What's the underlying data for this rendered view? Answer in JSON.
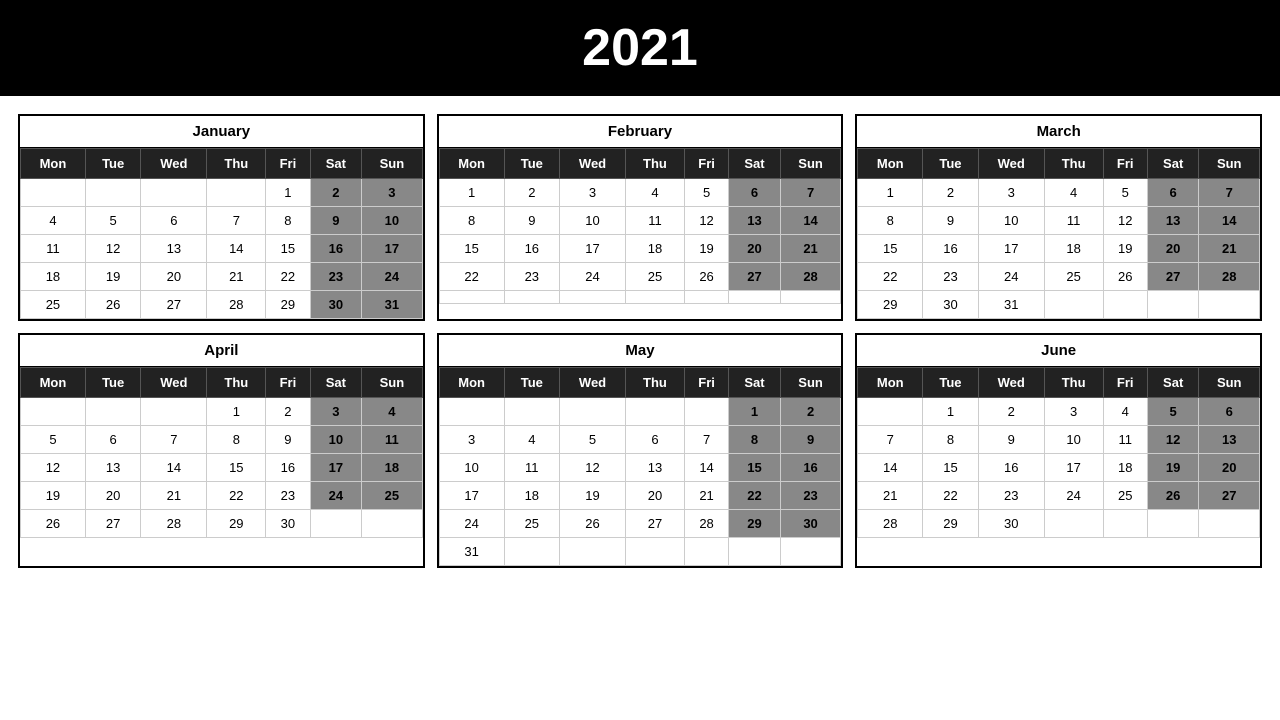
{
  "year": "2021",
  "months": [
    {
      "name": "January",
      "weeks": [
        [
          "",
          "",
          "",
          "",
          "1",
          "2",
          "3"
        ],
        [
          "4",
          "5",
          "6",
          "7",
          "8",
          "9",
          "10"
        ],
        [
          "11",
          "12",
          "13",
          "14",
          "15",
          "16",
          "17"
        ],
        [
          "18",
          "19",
          "20",
          "21",
          "22",
          "23",
          "24"
        ],
        [
          "25",
          "26",
          "27",
          "28",
          "29",
          "30",
          "31"
        ]
      ]
    },
    {
      "name": "February",
      "weeks": [
        [
          "1",
          "2",
          "3",
          "4",
          "5",
          "6",
          "7"
        ],
        [
          "8",
          "9",
          "10",
          "11",
          "12",
          "13",
          "14"
        ],
        [
          "15",
          "16",
          "17",
          "18",
          "19",
          "20",
          "21"
        ],
        [
          "22",
          "23",
          "24",
          "25",
          "26",
          "27",
          "28"
        ],
        [
          "",
          "",
          "",
          "",
          "",
          "",
          ""
        ]
      ]
    },
    {
      "name": "March",
      "weeks": [
        [
          "1",
          "2",
          "3",
          "4",
          "5",
          "6",
          "7"
        ],
        [
          "8",
          "9",
          "10",
          "11",
          "12",
          "13",
          "14"
        ],
        [
          "15",
          "16",
          "17",
          "18",
          "19",
          "20",
          "21"
        ],
        [
          "22",
          "23",
          "24",
          "25",
          "26",
          "27",
          "28"
        ],
        [
          "29",
          "30",
          "31",
          "",
          "",
          "",
          ""
        ]
      ]
    },
    {
      "name": "April",
      "weeks": [
        [
          "",
          "",
          "",
          "1",
          "2",
          "3",
          "4"
        ],
        [
          "5",
          "6",
          "7",
          "8",
          "9",
          "10",
          "11"
        ],
        [
          "12",
          "13",
          "14",
          "15",
          "16",
          "17",
          "18"
        ],
        [
          "19",
          "20",
          "21",
          "22",
          "23",
          "24",
          "25"
        ],
        [
          "26",
          "27",
          "28",
          "29",
          "30",
          "",
          ""
        ]
      ]
    },
    {
      "name": "May",
      "weeks": [
        [
          "",
          "",
          "",
          "",
          "",
          "1",
          "2"
        ],
        [
          "3",
          "4",
          "5",
          "6",
          "7",
          "8",
          "9"
        ],
        [
          "10",
          "11",
          "12",
          "13",
          "14",
          "15",
          "16"
        ],
        [
          "17",
          "18",
          "19",
          "20",
          "21",
          "22",
          "23"
        ],
        [
          "24",
          "25",
          "26",
          "27",
          "28",
          "29",
          "30"
        ],
        [
          "31",
          "",
          "",
          "",
          "",
          "",
          ""
        ]
      ]
    },
    {
      "name": "June",
      "weeks": [
        [
          "",
          "1",
          "2",
          "3",
          "4",
          "5",
          "6"
        ],
        [
          "7",
          "8",
          "9",
          "10",
          "11",
          "12",
          "13"
        ],
        [
          "14",
          "15",
          "16",
          "17",
          "18",
          "19",
          "20"
        ],
        [
          "21",
          "22",
          "23",
          "24",
          "25",
          "26",
          "27"
        ],
        [
          "28",
          "29",
          "30",
          "",
          "",
          "",
          ""
        ]
      ]
    }
  ],
  "days": [
    "Mon",
    "Tue",
    "Wed",
    "Thu",
    "Fri",
    "Sat",
    "Sun"
  ]
}
